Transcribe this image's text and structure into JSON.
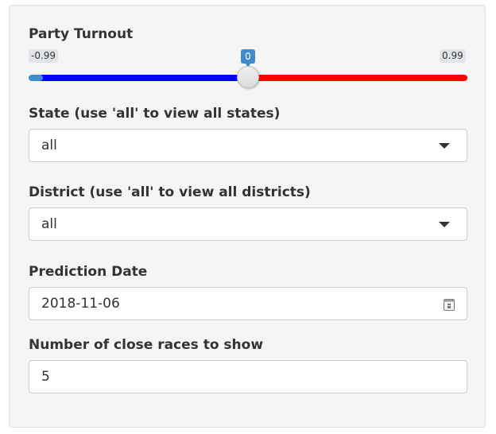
{
  "turnout": {
    "label": "Party Turnout",
    "min": "-0.99",
    "max": "0.99",
    "value": "0",
    "value_fraction": 0.5,
    "colors": {
      "left": "#0000ff",
      "right": "#ff0000",
      "accent": "#428bca"
    }
  },
  "state": {
    "label": "State (use 'all' to view all states)",
    "value": "all"
  },
  "district": {
    "label": "District (use 'all' to view all districts)",
    "value": "all"
  },
  "prediction_date": {
    "label": "Prediction Date",
    "value": "2018-11-06"
  },
  "close_races": {
    "label": "Number of close races to show",
    "value": "5"
  },
  "icons": {
    "select": "chevron-down-icon",
    "date": "calendar-icon"
  }
}
